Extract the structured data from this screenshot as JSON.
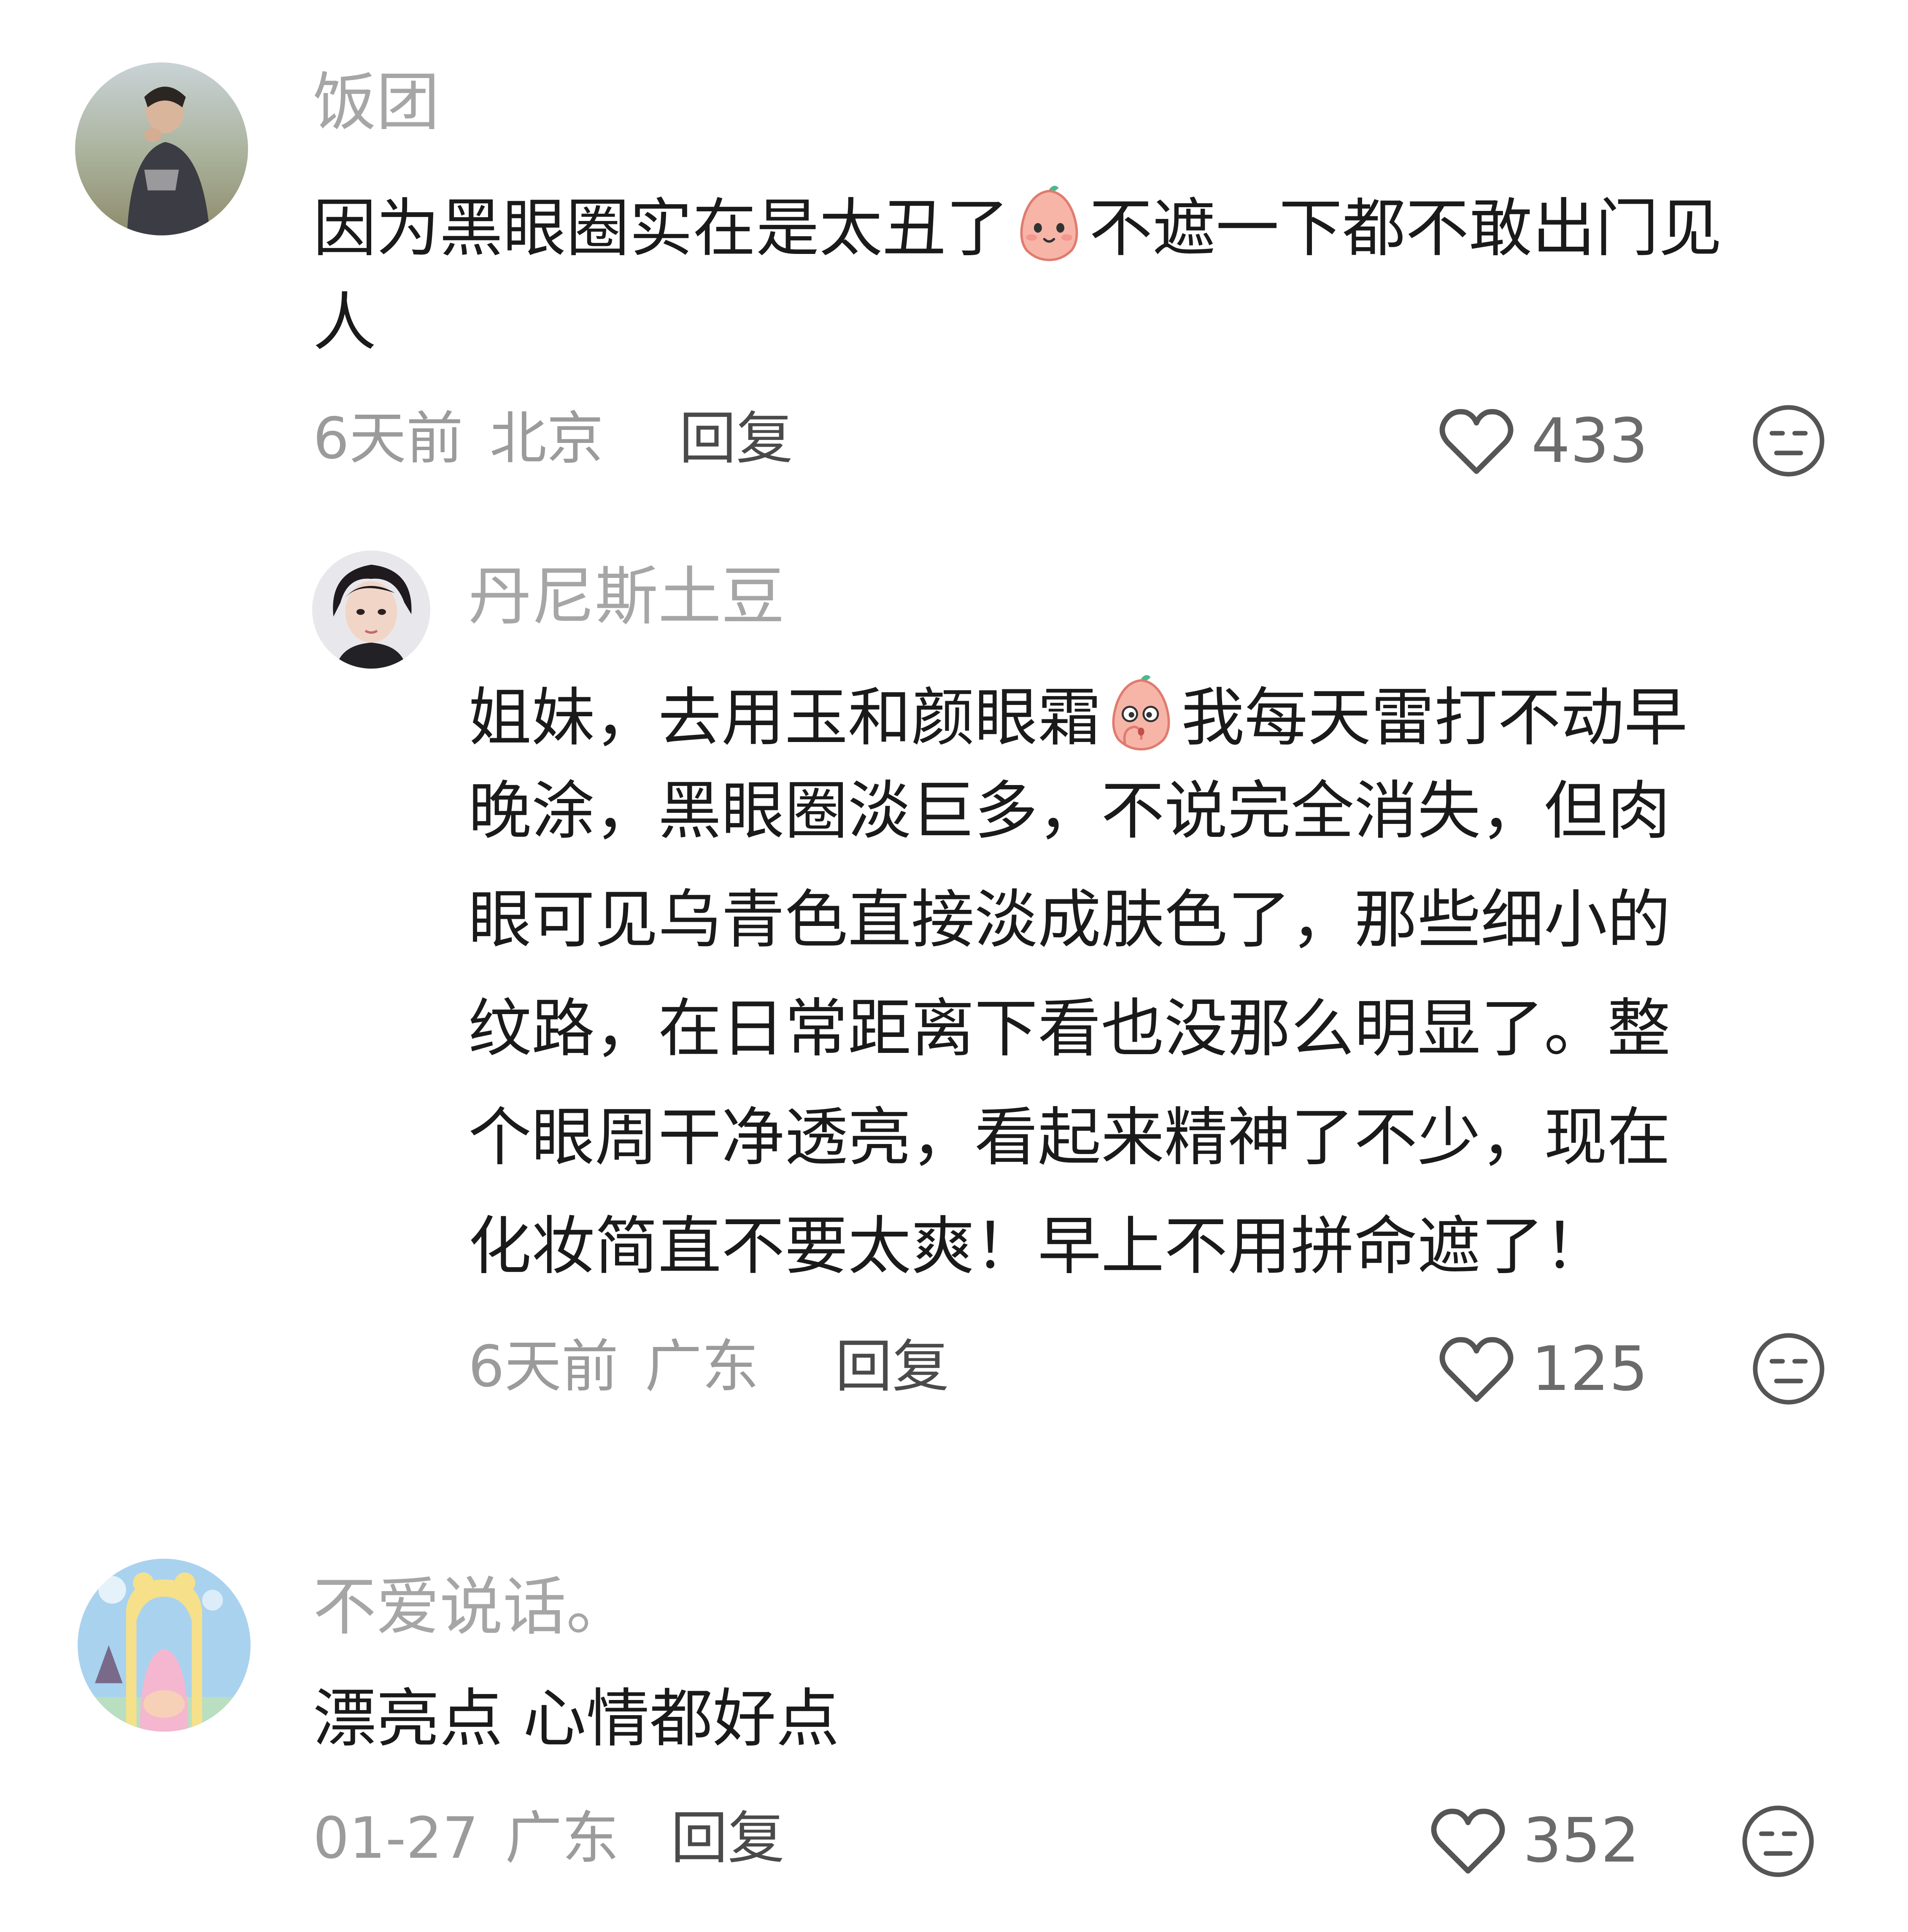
{
  "comments": [
    {
      "username": "饭团",
      "content_lines": [
        "因为黑眼圈实在是太丑了",
        "不遮一下都不敢出门见",
        "人"
      ],
      "emoji": "smile-emoji",
      "time": "6天前",
      "location": "北京",
      "reply_label": "回复",
      "likes": "433",
      "replies": [
        {
          "username": "丹尼斯土豆",
          "content_lines": [
            "姐妹，去用玉和颜眼霜",
            "我每天雷打不动早",
            "晚涂，黑眼圈淡巨多，不说完全消失，但肉",
            "眼可见乌青色直接淡成肤色了，那些细小的",
            "纹路，在日常距离下看也没那么明显了。整",
            "个眼周干净透亮，看起来精神了不少，现在",
            "化妆简直不要太爽！早上不用拼命遮了！"
          ],
          "emoji": "surprised-emoji",
          "time": "6天前",
          "location": "广东",
          "reply_label": "回复",
          "likes": "125"
        }
      ]
    },
    {
      "username": "不爱说话。",
      "content_lines": [
        "漂亮点 心情都好点"
      ],
      "time": "01-27",
      "location": "广东",
      "reply_label": "回复",
      "likes": "352"
    }
  ],
  "icons": {
    "like": "heart-outline-icon",
    "dislike": "unamused-face-icon"
  },
  "colors": {
    "text_primary": "#1a1a1a",
    "text_secondary": "#9b9b9b",
    "username": "#a6a6a6",
    "icon": "#555555"
  }
}
